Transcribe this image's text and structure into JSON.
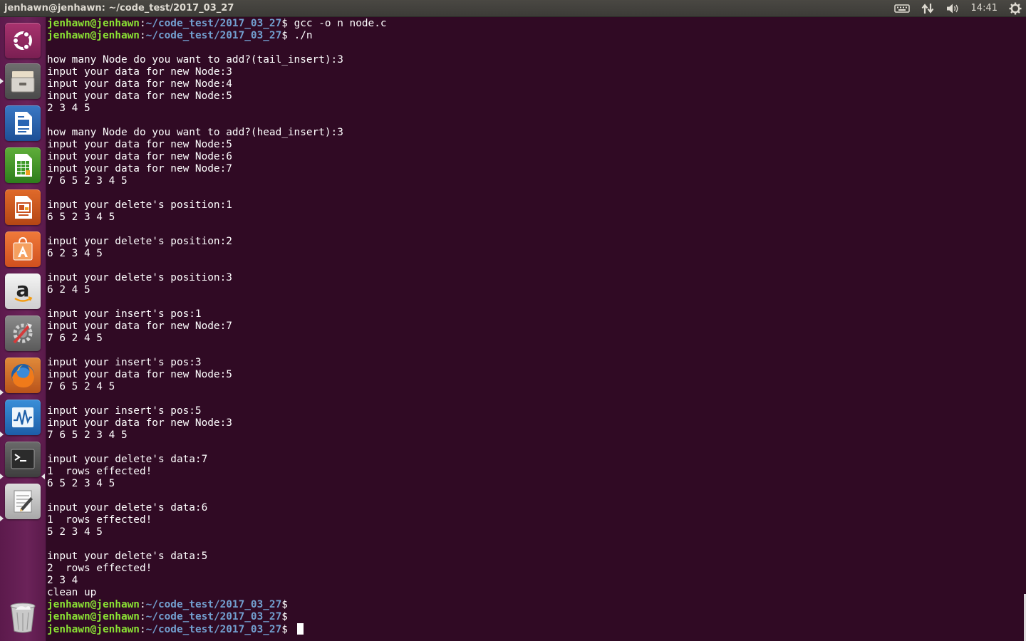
{
  "panel": {
    "title": "jenhawn@jenhawn: ~/code_test/2017_03_27",
    "clock": "14:41",
    "indicator_icons": [
      "keyboard-icon",
      "network-icon",
      "volume-icon",
      "gear-icon"
    ]
  },
  "launcher": {
    "items": [
      {
        "name": "ubuntu-dash",
        "icon": "ubuntu-logo-icon"
      },
      {
        "name": "files",
        "icon": "file-cabinet-icon"
      },
      {
        "name": "libreoffice-writer",
        "icon": "writer-document-icon"
      },
      {
        "name": "libreoffice-calc",
        "icon": "calc-spreadsheet-icon"
      },
      {
        "name": "libreoffice-impress",
        "icon": "impress-presentation-icon"
      },
      {
        "name": "ubuntu-software",
        "icon": "shopping-bag-icon"
      },
      {
        "name": "amazon",
        "icon": "amazon-icon"
      },
      {
        "name": "system-settings",
        "icon": "settings-tools-icon"
      },
      {
        "name": "firefox",
        "icon": "firefox-icon"
      },
      {
        "name": "system-monitor",
        "icon": "system-monitor-icon"
      },
      {
        "name": "terminal",
        "icon": "terminal-icon"
      },
      {
        "name": "text-editor",
        "icon": "text-editor-icon"
      },
      {
        "name": "trash",
        "icon": "trash-icon"
      }
    ]
  },
  "terminal": {
    "prompt_user": "jenhawn@jenhawn",
    "prompt_path": "~/code_test/2017_03_27",
    "lines": [
      {
        "kind": "prompt",
        "cmd": " gcc -o n node.c"
      },
      {
        "kind": "prompt",
        "cmd": " ./n"
      },
      {
        "kind": "out",
        "text": ""
      },
      {
        "kind": "out",
        "text": "how many Node do you want to add?(tail_insert):3"
      },
      {
        "kind": "out",
        "text": "input your data for new Node:3"
      },
      {
        "kind": "out",
        "text": "input your data for new Node:4"
      },
      {
        "kind": "out",
        "text": "input your data for new Node:5"
      },
      {
        "kind": "out",
        "text": "2 3 4 5"
      },
      {
        "kind": "out",
        "text": ""
      },
      {
        "kind": "out",
        "text": "how many Node do you want to add?(head_insert):3"
      },
      {
        "kind": "out",
        "text": "input your data for new Node:5"
      },
      {
        "kind": "out",
        "text": "input your data for new Node:6"
      },
      {
        "kind": "out",
        "text": "input your data for new Node:7"
      },
      {
        "kind": "out",
        "text": "7 6 5 2 3 4 5"
      },
      {
        "kind": "out",
        "text": ""
      },
      {
        "kind": "out",
        "text": "input your delete's position:1"
      },
      {
        "kind": "out",
        "text": "6 5 2 3 4 5"
      },
      {
        "kind": "out",
        "text": ""
      },
      {
        "kind": "out",
        "text": "input your delete's position:2"
      },
      {
        "kind": "out",
        "text": "6 2 3 4 5"
      },
      {
        "kind": "out",
        "text": ""
      },
      {
        "kind": "out",
        "text": "input your delete's position:3"
      },
      {
        "kind": "out",
        "text": "6 2 4 5"
      },
      {
        "kind": "out",
        "text": ""
      },
      {
        "kind": "out",
        "text": "input your insert's pos:1"
      },
      {
        "kind": "out",
        "text": "input your data for new Node:7"
      },
      {
        "kind": "out",
        "text": "7 6 2 4 5"
      },
      {
        "kind": "out",
        "text": ""
      },
      {
        "kind": "out",
        "text": "input your insert's pos:3"
      },
      {
        "kind": "out",
        "text": "input your data for new Node:5"
      },
      {
        "kind": "out",
        "text": "7 6 5 2 4 5"
      },
      {
        "kind": "out",
        "text": ""
      },
      {
        "kind": "out",
        "text": "input your insert's pos:5"
      },
      {
        "kind": "out",
        "text": "input your data for new Node:3"
      },
      {
        "kind": "out",
        "text": "7 6 5 2 3 4 5"
      },
      {
        "kind": "out",
        "text": ""
      },
      {
        "kind": "out",
        "text": "input your delete's data:7"
      },
      {
        "kind": "out",
        "text": "1  rows effected!"
      },
      {
        "kind": "out",
        "text": "6 5 2 3 4 5"
      },
      {
        "kind": "out",
        "text": ""
      },
      {
        "kind": "out",
        "text": "input your delete's data:6"
      },
      {
        "kind": "out",
        "text": "1  rows effected!"
      },
      {
        "kind": "out",
        "text": "5 2 3 4 5"
      },
      {
        "kind": "out",
        "text": ""
      },
      {
        "kind": "out",
        "text": "input your delete's data:5"
      },
      {
        "kind": "out",
        "text": "2  rows effected!"
      },
      {
        "kind": "out",
        "text": "2 3 4"
      },
      {
        "kind": "out",
        "text": "clean up"
      },
      {
        "kind": "prompt",
        "cmd": ""
      },
      {
        "kind": "prompt",
        "cmd": ""
      },
      {
        "kind": "prompt",
        "cmd": " ",
        "cursor": true
      }
    ]
  }
}
